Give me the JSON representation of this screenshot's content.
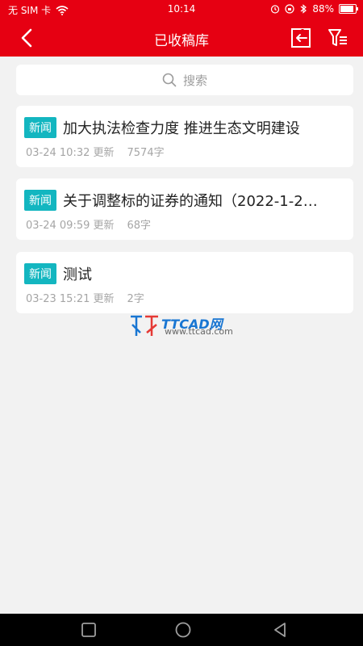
{
  "status": {
    "carrier": "无 SIM 卡",
    "time": "10:14",
    "battery": "88%",
    "battery_level": 0.88
  },
  "header": {
    "title": "已收稿库",
    "back_icon": "chevron-left-icon",
    "import_icon": "import-icon",
    "filter_icon": "filter-icon"
  },
  "search": {
    "placeholder": "搜索"
  },
  "items": [
    {
      "tag": "新闻",
      "title": "加大执法检查力度 推进生态文明建设",
      "time": "03-24 10:32 更新",
      "words": "7574字"
    },
    {
      "tag": "新闻",
      "title": "关于调整标的证券的通知（2022-1-2…",
      "time": "03-24 09:59 更新",
      "words": "68字"
    },
    {
      "tag": "新闻",
      "title": "测试",
      "time": "03-23 15:21 更新",
      "words": "2字"
    }
  ],
  "watermark": {
    "brand": "TTCAD网",
    "url": "www.ttcad.com"
  },
  "colors": {
    "brand_red": "#e60012",
    "tag_teal": "#13b6c0",
    "background": "#f2f2f2"
  }
}
